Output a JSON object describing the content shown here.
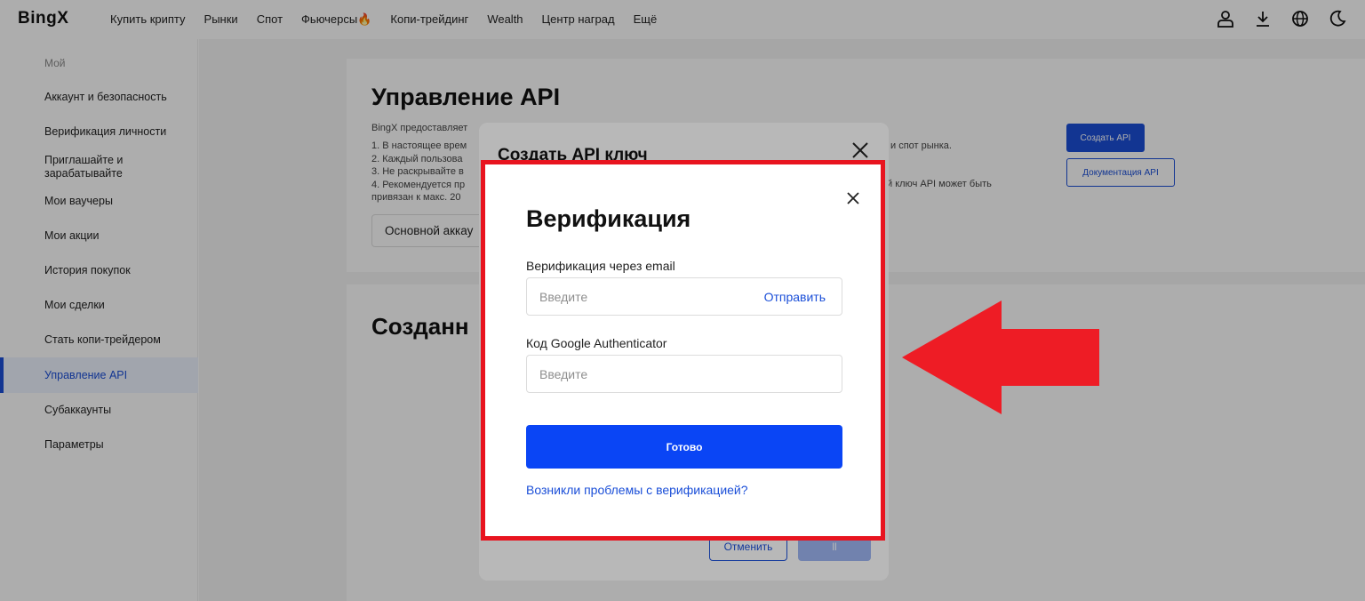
{
  "header": {
    "logo": "BingX",
    "nav": [
      "Купить крипту",
      "Рынки",
      "Спот",
      "Фьючерсы🔥",
      "Копи-трейдинг",
      "Wealth",
      "Центр наград",
      "Ещё"
    ],
    "icons": [
      "user-icon",
      "download-icon",
      "globe-icon",
      "moon-icon"
    ]
  },
  "sidebar": {
    "heading": "Мой",
    "items": [
      {
        "label": "Аккаунт и безопасность"
      },
      {
        "label": "Верификация личности"
      },
      {
        "label": "Приглашайте и зарабатывайте"
      },
      {
        "label": "Мои ваучеры"
      },
      {
        "label": "Мои акции"
      },
      {
        "label": "История покупок"
      },
      {
        "label": "Мои сделки"
      },
      {
        "label": "Стать копи-трейдером"
      },
      {
        "label": "Управление API"
      },
      {
        "label": "Субаккаунты"
      },
      {
        "label": "Параметры"
      }
    ],
    "active": "Управление API"
  },
  "main": {
    "title": "Управление API",
    "intro": "BingX предоставляет",
    "notes": [
      "1. В настоящее врем",
      "2. Каждый пользова",
      "3. Не раскрывайте в",
      "4. Рекомендуется пр",
      "привязан к макс. 20"
    ],
    "notes_right": [
      "ов и спот рынка.",
      "й ключ API может быть"
    ],
    "create_api_label": "Создать API",
    "docs_label": "Документация API",
    "account_select": "Основной аккау",
    "created_title": "Созданн"
  },
  "create_modal": {
    "title": "Создать API ключ",
    "cancel_label": "Отменить",
    "ok_label": "ll"
  },
  "verify_modal": {
    "title": "Верификация",
    "email_label": "Верификация через email",
    "email_placeholder": "Введите",
    "send_label": "Отправить",
    "ga_label": "Код Google Authenticator",
    "ga_placeholder": "Введите",
    "submit_label": "Готово",
    "help_link": "Возникли проблемы с верификацией?"
  },
  "colors": {
    "accent": "#1b4fd8",
    "primary_button": "#0a45f5",
    "highlight_frame": "#e8141f",
    "arrow": "#ee1c25"
  }
}
